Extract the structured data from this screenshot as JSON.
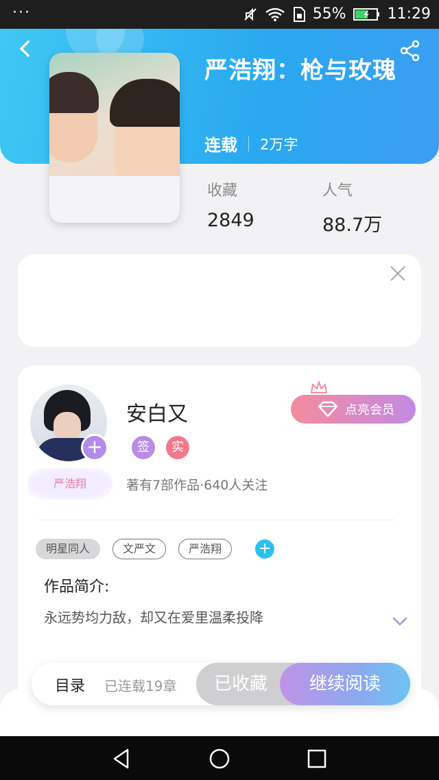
{
  "status_bar": {
    "menu_dots": "···",
    "battery_percent": "55%",
    "time": "11:29"
  },
  "book": {
    "title": "严浩翔：枪与玫瑰",
    "status": "连载",
    "word_count": "2万字",
    "stats": [
      {
        "label": "收藏",
        "value": "2849"
      },
      {
        "label": "人气",
        "value": "88.7万"
      }
    ]
  },
  "author": {
    "name": "安白又",
    "badge": "严浩翔",
    "sign_tag": "签",
    "real_tag": "实",
    "stats": "著有7部作品·640人关注",
    "follow_symbol": "+",
    "vip_label": "点亮会员"
  },
  "tags": [
    "明星同人",
    "文严文",
    "严浩翔"
  ],
  "tag_add_symbol": "+",
  "intro": {
    "title": "作品简介:",
    "text": "永远势均力敌，却又在爱里温柔投降"
  },
  "action_bar": {
    "toc": "目录",
    "chapters": "已连载19章",
    "collected": "已收藏",
    "continue_reading": "继续阅读"
  },
  "colors": {
    "header_blue": "#2aa8f0",
    "vip_pink": "#f48b9e",
    "vip_purple": "#c28ae2",
    "tag_add_blue": "#2bc0f2"
  }
}
